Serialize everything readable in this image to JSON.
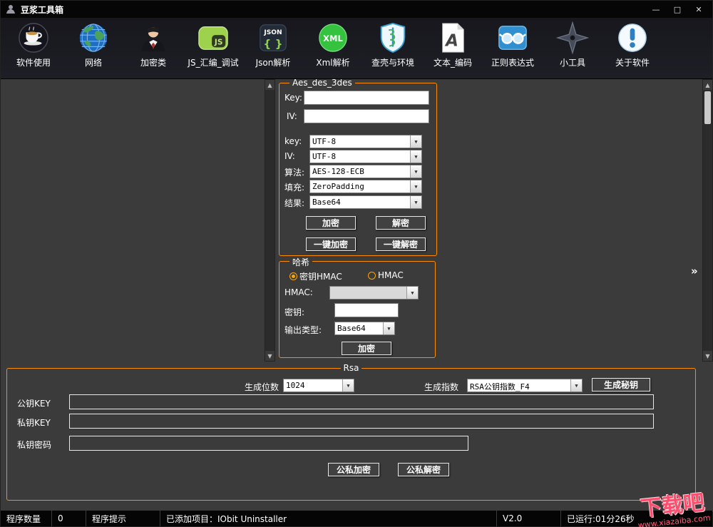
{
  "window": {
    "title": "豆浆工具箱",
    "controls": {
      "minimize": "—",
      "maximize": "□",
      "close": "✕"
    }
  },
  "glyphs": {
    "up": "▲",
    "down": "▼",
    "dropdown": "▼",
    "expand": "»"
  },
  "toolbar": {
    "items": [
      {
        "label": "软件使用",
        "icon": "coffee-icon"
      },
      {
        "label": "网络",
        "icon": "globe-icon"
      },
      {
        "label": "加密类",
        "icon": "person-icon"
      },
      {
        "label": "JS_汇编_调试",
        "icon": "js-icon"
      },
      {
        "label": "Json解析",
        "icon": "json-icon"
      },
      {
        "label": "Xml解析",
        "icon": "xml-icon"
      },
      {
        "label": "查壳与环境",
        "icon": "shield-icon"
      },
      {
        "label": "文本_编码",
        "icon": "document-icon"
      },
      {
        "label": "正则表达式",
        "icon": "glasses-icon"
      },
      {
        "label": "小工具",
        "icon": "shuriken-icon"
      },
      {
        "label": "关于软件",
        "icon": "info-icon"
      }
    ]
  },
  "aes": {
    "title": "Aes_des_3des",
    "key_label": "Key:",
    "iv_label": "IV:",
    "key_value": "",
    "iv_value": "",
    "rows": [
      {
        "label": "key:",
        "value": "UTF-8"
      },
      {
        "label": "IV:",
        "value": "UTF-8"
      },
      {
        "label": "算法:",
        "value": "AES-128-ECB"
      },
      {
        "label": "填充:",
        "value": "ZeroPadding"
      },
      {
        "label": "结果:",
        "value": "Base64"
      }
    ],
    "buttons": {
      "encrypt": "加密",
      "decrypt": "解密",
      "one_encrypt": "一键加密",
      "one_decrypt": "一键解密"
    }
  },
  "hash": {
    "title": "哈希",
    "radios": [
      {
        "label": "密钥HMAC",
        "checked": true
      },
      {
        "label": "HMAC",
        "checked": false
      }
    ],
    "hmac_label": "HMAC:",
    "hmac_value": "",
    "key_label": "密钥:",
    "key_value": "",
    "output_label": "输出类型:",
    "output_value": "Base64",
    "encrypt": "加密"
  },
  "rsa": {
    "title": "Rsa",
    "bits_label": "生成位数",
    "bits_value": "1024",
    "exp_label": "生成指数",
    "exp_value": "RSA公钥指数_F4",
    "generate": "生成秘钥",
    "pub_label": "公钥KEY",
    "pub_value": "",
    "priv_label": "私钥KEY",
    "priv_value": "",
    "pass_label": "私钥密码",
    "pass_value": "",
    "encrypt": "公私加密",
    "decrypt": "公私解密"
  },
  "statusbar": {
    "items": [
      "程序数量",
      "0",
      "程序提示",
      "已添加项目：IObit Uninstaller",
      "V2.0",
      "已运行:01分26秒"
    ]
  },
  "watermark": {
    "title": "下载吧",
    "url": "www.xiazaiba.com"
  }
}
